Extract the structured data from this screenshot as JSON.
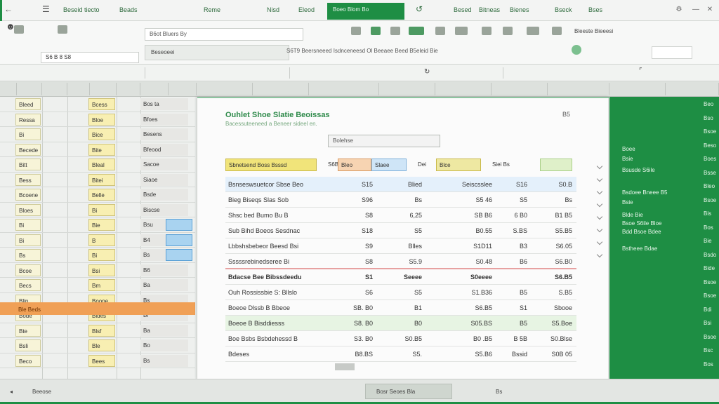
{
  "window": {
    "tabs": [
      "Beseid tiecto",
      "Beads",
      "Reme",
      "Nisd",
      "Eleod",
      "Besed",
      "Bitneas",
      "Bienes",
      "Bseck",
      "Bses"
    ],
    "active_tab": "Boeo Blom Bo"
  },
  "ribbon": {
    "name_box": "S6 B 8 S8",
    "font_box": "B6ot Bluers By",
    "formula_label": "Beseoeei",
    "formula_text": "S6T9 Beersneeed Isdnceneesd Ol Beeaee Beed B5eleid Bie",
    "search_label": "Bleeste Bieeesi"
  },
  "grid_left": {
    "col_a": [
      "Bleed",
      "Ressa",
      "Bi",
      "Becede",
      "Bitt",
      "Bess",
      "Bcoene",
      "Bloes",
      "Bi",
      "Bi",
      "Bs",
      "Bcoe",
      "Becs",
      "Blin",
      "Bode",
      "Bte",
      "Bsli",
      "Beco"
    ],
    "col_b": [
      "Bcess",
      "Bloe",
      "Bice",
      "Bite",
      "Bleal",
      "Bitei",
      "Belle",
      "Bi",
      "Bie",
      "B",
      "Bi",
      "Bsi",
      "Bm",
      "Boone",
      "Bides",
      "Blsf",
      "Ble",
      "Bees"
    ],
    "col_c": [
      "Bos ta",
      "Bfoes",
      "Besens",
      "Bfeood",
      "Sacoe",
      "Siaoe",
      "Bsde",
      "Biscse",
      "Bsu",
      "B4",
      "Bs",
      "B6",
      "Ba",
      "Bs",
      "Bi",
      "Ba",
      "Bo",
      "Bs"
    ],
    "orange_row": "Ble Beds"
  },
  "dialog": {
    "title": "Ouhlet Shoe Slatie Beoissas",
    "subtitle": "Bacessuteeneed a Beneer sideel en.",
    "help": "B5",
    "dropdown": "Bolehse",
    "headers": [
      "Sbnetsend Boss Bsssd",
      "S6B B",
      "Bleo",
      "Slaee",
      "Dei",
      "Blce",
      "Siei Bs"
    ],
    "rows": [
      {
        "label": "Bsnseswsuetcor Sbse Beo",
        "v1": "S15",
        "v2": "Blied",
        "v3": "Seiscsslee",
        "v4": "S16",
        "v5": "S0.B"
      },
      {
        "label": "Bieg Biseqs Slas Sob",
        "v1": "S96",
        "v2": "Bs",
        "v3": "S5 46",
        "v4": "S5",
        "v5": "Bs"
      },
      {
        "label": "Shsc bed Bumo Bu   B",
        "v1": "S8",
        "v2": "6,25",
        "v3": "SB B6",
        "v4": "6 B0",
        "v5": "B1 B5"
      },
      {
        "label": "Sub Bihd Boeos Sesdnac",
        "v1": "S18",
        "v2": "S5",
        "v3": "B0.55",
        "v4": "S.BS",
        "v5": "S5.B5"
      },
      {
        "label": "Lbbshsbebeor Beesd Bsi",
        "v1": "S9",
        "v2": "Blles",
        "v3": "S1D11",
        "v4": "B3",
        "v5": "S6.05"
      },
      {
        "label": "Sssssrebinedseree Bi",
        "v1": "S8",
        "v2": "S5.9",
        "v3": "S0.48",
        "v4": "B6",
        "v5": "S6.B0"
      },
      {
        "label": "Bdacse Bee Bibssdeedu",
        "v1": "S1",
        "v2": "Seeee",
        "v3": "S0eeee",
        "v4": "",
        "v5": "S6.B5"
      },
      {
        "label": "Ouh Rossissbie S: Bllslo",
        "v1": "S6",
        "v2": "S5",
        "v3": "S1.B36",
        "v4": "B5",
        "v5": "S.B5"
      },
      {
        "label": "Boeoe Dlssb B Bbeoe",
        "v1": "SB. B0",
        "v2": "B1",
        "v3": "S6.B5",
        "v4": "S1",
        "v5": "Sbooe"
      },
      {
        "label": "Boeoe B Bisddiesss",
        "v1": "S8. B0",
        "v2": "B0",
        "v3": "S05.BS",
        "v4": "B5",
        "v5": "S5.Boe"
      },
      {
        "label": "Boe Bsbs Bsbdehessd B",
        "v1": "S3. B0",
        "v2": "S0.B5",
        "v3": "B0 .B5",
        "v4": "B 5B",
        "v5": "S0.Blse"
      },
      {
        "label": "Bdeses",
        "v1": "B8.BS",
        "v2": "S5.",
        "v3": "S5.B6",
        "v4": "Bssid",
        "v5": "S0B 05"
      }
    ]
  },
  "pane": {
    "items_left": [
      "Boee",
      "Bsie",
      "Bsusde S6ile",
      "Bsdoee Bneee B5",
      "Bsie",
      "Blde Bie",
      "Bsoe S6ile Bloe",
      "Bdd Bsoe Bdee",
      "Bstheee Bdae"
    ],
    "items_right": [
      "Beo",
      "Bso",
      "Bsoe",
      "Beso",
      "Boes",
      "Bsse",
      "Bleo",
      "Bsoe",
      "Bis",
      "Bos",
      "Bie",
      "Bsdo",
      "Bide",
      "Bsoe",
      "Bsoe",
      "Bdi",
      "Bsi",
      "Bsoe",
      "Bsc",
      "Bos"
    ]
  },
  "statusbar": {
    "left": "Beeose",
    "center": "Bosr Seoes Bla",
    "right": "Bs"
  }
}
